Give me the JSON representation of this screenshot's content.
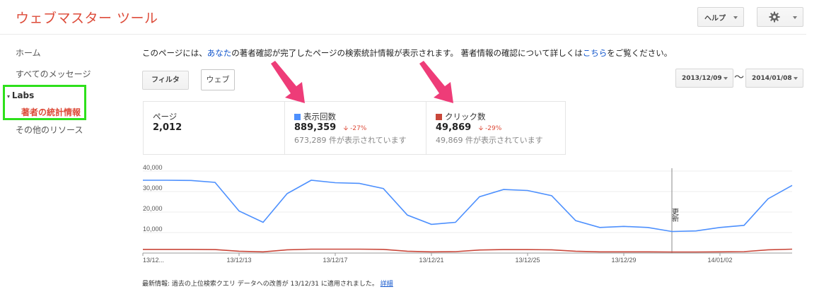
{
  "header": {
    "app_title": "ウェブマスター ツール",
    "help_label": "ヘルプ",
    "settings_icon": "gear-icon"
  },
  "sidebar": {
    "items": [
      {
        "label": "ホーム"
      },
      {
        "label": "すべてのメッセージ"
      },
      {
        "label": "Labs"
      },
      {
        "label": "著者の統計情報"
      },
      {
        "label": "その他のリソース"
      }
    ],
    "highlight_color": "#2ee01b"
  },
  "intro": {
    "before": "このページには、",
    "link1": "あなた",
    "middle": "の著者確認が完了したページの検索統計情報が表示されます。 著者情報の確認について詳しくは",
    "link2": "こちら",
    "after": "をご覧ください。"
  },
  "controls": {
    "filter_label": "フィルタ",
    "web_label": "ウェブ",
    "start_date": "2013/12/09",
    "date_separator": "〜",
    "end_date": "2014/01/08"
  },
  "stats": [
    {
      "label": "ページ",
      "value": "2,012",
      "change": "",
      "sub": "",
      "color": ""
    },
    {
      "label": "表示回数",
      "value": "889,359",
      "change": "-27%",
      "sub": "673,289 件が表示されています",
      "color": "#4d90fe"
    },
    {
      "label": "クリック数",
      "value": "49,869",
      "change": "-29%",
      "sub": "49,869 件が表示されています",
      "color": "#c9473a"
    }
  ],
  "chart_data": {
    "type": "line",
    "y_ticks": [
      "40,000",
      "30,000",
      "20,000",
      "10,000"
    ],
    "ylim": [
      0,
      40000
    ],
    "x_tick_labels": [
      "13/12...",
      "13/12/13",
      "13/12/17",
      "13/12/21",
      "13/12/25",
      "13/12/29",
      "14/01/02"
    ],
    "x": [
      "2013-12-09",
      "2013-12-10",
      "2013-12-11",
      "2013-12-12",
      "2013-12-13",
      "2013-12-14",
      "2013-12-15",
      "2013-12-16",
      "2013-12-17",
      "2013-12-18",
      "2013-12-19",
      "2013-12-20",
      "2013-12-21",
      "2013-12-22",
      "2013-12-23",
      "2013-12-24",
      "2013-12-25",
      "2013-12-26",
      "2013-12-27",
      "2013-12-28",
      "2013-12-29",
      "2013-12-30",
      "2013-12-31",
      "2014-01-01",
      "2014-01-02",
      "2014-01-03",
      "2014-01-04",
      "2014-01-05"
    ],
    "series": [
      {
        "color": "#4d90fe",
        "values": [
          35500,
          35500,
          35400,
          34500,
          20500,
          15000,
          29000,
          35500,
          34300,
          34000,
          31500,
          18500,
          14000,
          15000,
          27500,
          31000,
          30500,
          28000,
          15800,
          12500,
          13000,
          12500,
          10500,
          10800,
          12500,
          13500,
          26500,
          33000
        ]
      },
      {
        "color": "#c9473a",
        "values": [
          1800,
          1800,
          1800,
          1700,
          900,
          600,
          1600,
          1900,
          1900,
          1900,
          1800,
          900,
          600,
          700,
          1500,
          1700,
          1700,
          1600,
          900,
          600,
          600,
          600,
          500,
          500,
          600,
          700,
          1600,
          1900
        ]
      }
    ],
    "annotation": {
      "x": "2013-12-31",
      "label": "更新"
    },
    "grid": true
  },
  "footer": {
    "text": "最新情報: 過去の上位検索クエリ データへの改善が 13/12/31 に適用されました。",
    "link": "詳細"
  },
  "arrow_color": "#ee3c78"
}
